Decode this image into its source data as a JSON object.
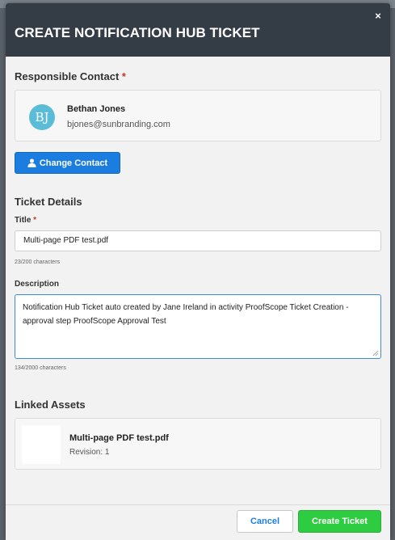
{
  "modal": {
    "title": "CREATE NOTIFICATION HUB TICKET",
    "close_icon": "close-icon",
    "close_glyph": "×"
  },
  "responsible_contact": {
    "label": "Responsible Contact",
    "required_mark": "*",
    "avatar_initials": "BJ",
    "avatar_color": "#5bbcd8",
    "name": "Bethan Jones",
    "email": "bjones@sunbranding.com",
    "change_button_label": "Change Contact",
    "change_button_icon": "user-icon"
  },
  "ticket_details": {
    "heading": "Ticket Details",
    "title_label": "Title",
    "title_required_mark": "*",
    "title_value": "Multi-page PDF test.pdf",
    "title_char_count": "23/200 characters",
    "description_label": "Description",
    "description_value": "Notification Hub Ticket auto created by  Jane Ireland in activity ProofScope Ticket Creation - approval step ProofScope Approval Test",
    "description_char_count": "134/2000 characters"
  },
  "linked_assets": {
    "heading": "Linked Assets",
    "items": [
      {
        "name": "Multi-page PDF test.pdf",
        "revision": "Revision: 1"
      }
    ]
  },
  "footer": {
    "cancel_label": "Cancel",
    "create_label": "Create Ticket"
  },
  "colors": {
    "header_bg": "#343c46",
    "primary": "#1c7de0",
    "success": "#2ecc40",
    "required": "#c0392b"
  }
}
